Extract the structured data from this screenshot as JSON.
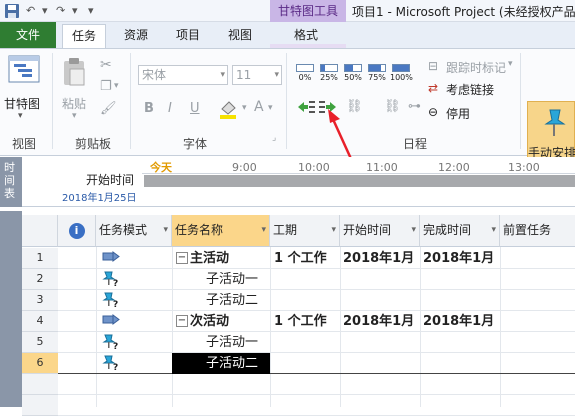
{
  "quick_access": {
    "undo": "↶",
    "redo": "↷",
    "more": "▾"
  },
  "context_tab_group": "甘特图工具",
  "window_title": "项目1 - Microsoft Project (未经授权产品)",
  "tabs": [
    "文件",
    "任务",
    "资源",
    "项目",
    "视图",
    "格式"
  ],
  "ribbon": {
    "view_group": {
      "gantt_label": "甘特图",
      "label": "视图"
    },
    "clipboard": {
      "paste_label": "粘贴",
      "label": "剪贴板"
    },
    "font": {
      "font_name": "宋体",
      "font_size": "11",
      "bold": "B",
      "italic": "I",
      "underline": "U",
      "label": "字体"
    },
    "schedule": {
      "pct": [
        "0%",
        "25%",
        "50%",
        "75%",
        "100%"
      ],
      "track_label": "跟踪时标记",
      "respect_links": "考虑链接",
      "inactivate": "停用",
      "label": "日程"
    },
    "manual_schedule": "手动安排"
  },
  "timeline": {
    "side": "时间表",
    "start_label": "开始时间",
    "start_date": "2018年1月25日",
    "today": "今天",
    "times": [
      "9:00",
      "10:00",
      "11:00",
      "12:00",
      "13:00"
    ]
  },
  "columns": [
    "任务模式",
    "任务名称",
    "工期",
    "开始时间",
    "完成时间",
    "前置任务"
  ],
  "rows": [
    {
      "id": "1",
      "mode": "auto",
      "name": "主活动",
      "summary": true,
      "duration": "1 个工作",
      "start": "2018年1月",
      "finish": "2018年1月"
    },
    {
      "id": "2",
      "mode": "manual",
      "name": "子活动一",
      "summary": false,
      "duration": "",
      "start": "",
      "finish": ""
    },
    {
      "id": "3",
      "mode": "manual",
      "name": "子活动二",
      "summary": false,
      "duration": "",
      "start": "",
      "finish": ""
    },
    {
      "id": "4",
      "mode": "auto",
      "name": "次活动",
      "summary": true,
      "duration": "1 个工作",
      "start": "2018年1月",
      "finish": "2018年1月"
    },
    {
      "id": "5",
      "mode": "manual",
      "name": "子活动一",
      "summary": false,
      "duration": "",
      "start": "",
      "finish": ""
    },
    {
      "id": "6",
      "mode": "manual",
      "name": "子活动二",
      "summary": false,
      "duration": "",
      "start": "",
      "finish": "",
      "selected": true
    }
  ],
  "colors": {
    "file_tab": "#2f7d32",
    "context": "#c9b6e6",
    "selection": "#000000",
    "arrow": "#e8202a"
  }
}
